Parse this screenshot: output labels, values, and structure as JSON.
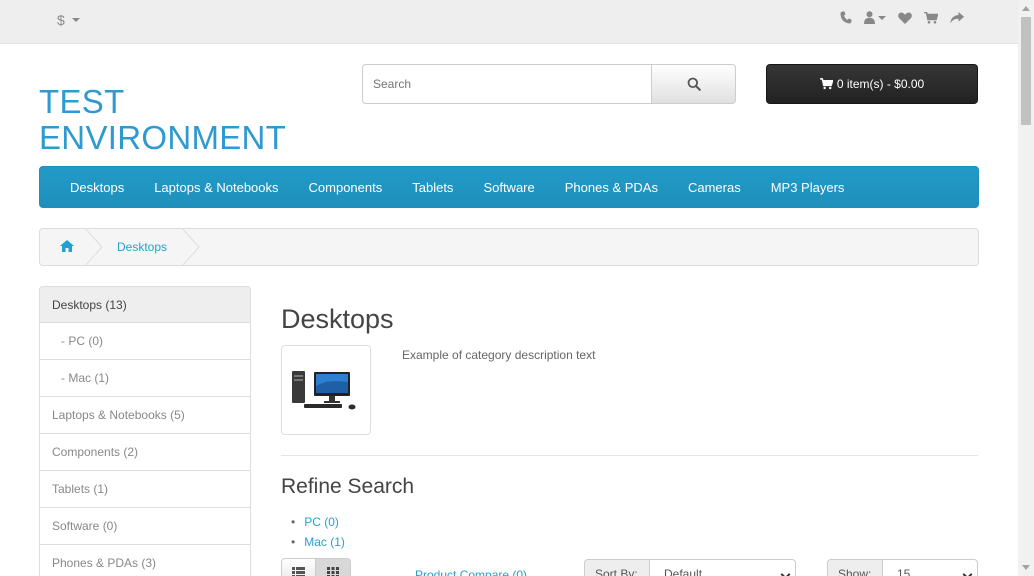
{
  "topbar": {
    "currency": "$",
    "icons": [
      "phone-icon",
      "user-icon",
      "heart-icon",
      "cart-icon",
      "share-icon"
    ]
  },
  "header": {
    "logo_line1": "TEST",
    "logo_line2": "ENVIRONMENT",
    "search_placeholder": "Search",
    "cart_label": "0 item(s) - $0.00"
  },
  "menu": {
    "items": [
      "Desktops",
      "Laptops & Notebooks",
      "Components",
      "Tablets",
      "Software",
      "Phones & PDAs",
      "Cameras",
      "MP3 Players"
    ]
  },
  "breadcrumb": {
    "current": "Desktops"
  },
  "sidebar": {
    "items": [
      "Desktops (13)",
      "- PC (0)",
      "- Mac (1)",
      "Laptops & Notebooks (5)",
      "Components (2)",
      "Tablets (1)",
      "Software (0)",
      "Phones & PDAs (3)"
    ]
  },
  "content": {
    "title": "Desktops",
    "description": "Example of category description text",
    "refine_title": "Refine Search",
    "refine_items": [
      "PC (0)",
      "Mac (1)"
    ],
    "compare_link": "Product Compare (0)",
    "sort_label": "Sort By:",
    "sort_value": "Default",
    "show_label": "Show:",
    "show_value": "15"
  },
  "colors": {
    "accent": "#229ac8",
    "link": "#23a1d1",
    "cart_button": "#303030"
  }
}
